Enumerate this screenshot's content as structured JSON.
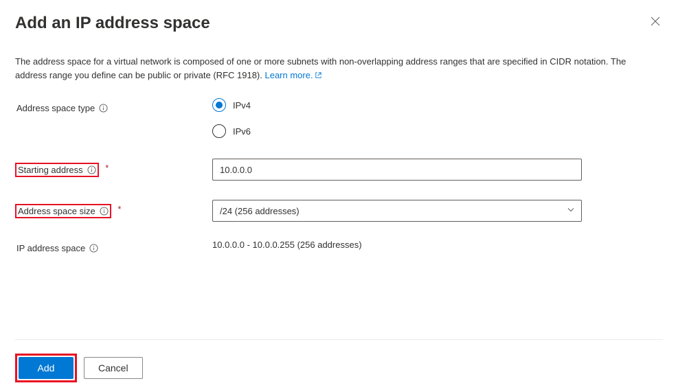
{
  "title": "Add an IP address space",
  "description_prefix": "The address space for a virtual network is composed of one or more subnets with non-overlapping address ranges that are specified in CIDR notation. The address range you define can be public or private (RFC 1918). ",
  "learn_more": "Learn more.",
  "labels": {
    "type": "Address space type",
    "starting": "Starting address",
    "size": "Address space size",
    "summary": "IP address space"
  },
  "radio": {
    "ipv4": "IPv4",
    "ipv6": "IPv6",
    "selected": "ipv4"
  },
  "starting_address_value": "10.0.0.0",
  "size_selected": "/24 (256 addresses)",
  "summary_value": "10.0.0.0 - 10.0.0.255 (256 addresses)",
  "buttons": {
    "add": "Add",
    "cancel": "Cancel"
  }
}
